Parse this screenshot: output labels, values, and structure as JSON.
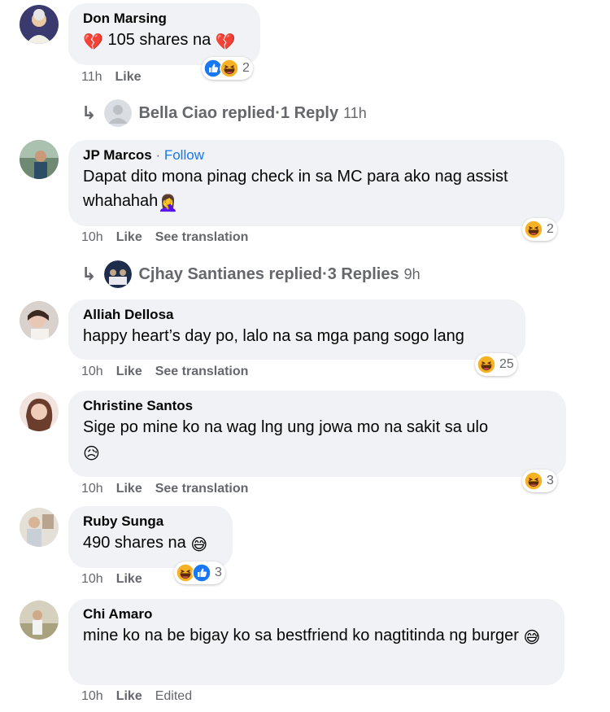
{
  "comments": [
    {
      "name": "Don Marsing",
      "text_prefix": "💔",
      "text": " 105 shares na ",
      "text_suffix": "💔",
      "time": "11h",
      "like": "Like",
      "reactions": {
        "icons": [
          "like-icon",
          "haha-icon"
        ],
        "count": "2"
      }
    },
    {
      "name": "JP Marcos",
      "separator": " · ",
      "follow": "Follow",
      "text": "Dapat dito mona pinag check in sa MC para ako nag assist whahahah",
      "text_suffix": "🤦‍♀️",
      "time": "10h",
      "like": "Like",
      "translate": "See translation",
      "reactions": {
        "icons": [
          "haha-icon"
        ],
        "count": "2"
      }
    },
    {
      "name": "Alliah Dellosa",
      "text": "happy heart’s day po, lalo na sa mga pang sogo lang",
      "time": "10h",
      "like": "Like",
      "translate": "See translation",
      "reactions": {
        "icons": [
          "haha-icon"
        ],
        "count": "25"
      }
    },
    {
      "name": "Christine Santos",
      "text": "Sige po mine ko na wag lng ung jowa mo na sakit sa ulo",
      "text_suffix": "😥",
      "time": "10h",
      "like": "Like",
      "translate": "See translation",
      "reactions": {
        "icons": [
          "haha-icon"
        ],
        "count": "3"
      }
    },
    {
      "name": "Ruby Sunga",
      "text": "490 shares na ",
      "text_suffix": "😅",
      "time": "10h",
      "like": "Like",
      "reactions": {
        "icons": [
          "haha-icon",
          "like-icon"
        ],
        "count": "3"
      }
    },
    {
      "name": "Chi Amaro",
      "text": "mine ko na be bigay ko sa bestfriend ko nagtitinda ng burger ",
      "text_suffix": "😅",
      "time": "10h",
      "like": "Like",
      "edited": "Edited"
    }
  ],
  "replies": [
    {
      "arrow": "↳",
      "name": "Bella Ciao replied",
      "sep": " · ",
      "count": "1 Reply",
      "time": "11h"
    },
    {
      "arrow": "↳",
      "name": "Cjhay Santianes replied",
      "sep": " · ",
      "count": "3 Replies",
      "time": "9h"
    }
  ],
  "colors": {
    "bubble": "#f0f2f5",
    "meta": "#65676b",
    "text": "#050505",
    "link_blue": "#1877f2",
    "like_blue": "#1877f2",
    "haha_yellow": "#f7b125"
  }
}
